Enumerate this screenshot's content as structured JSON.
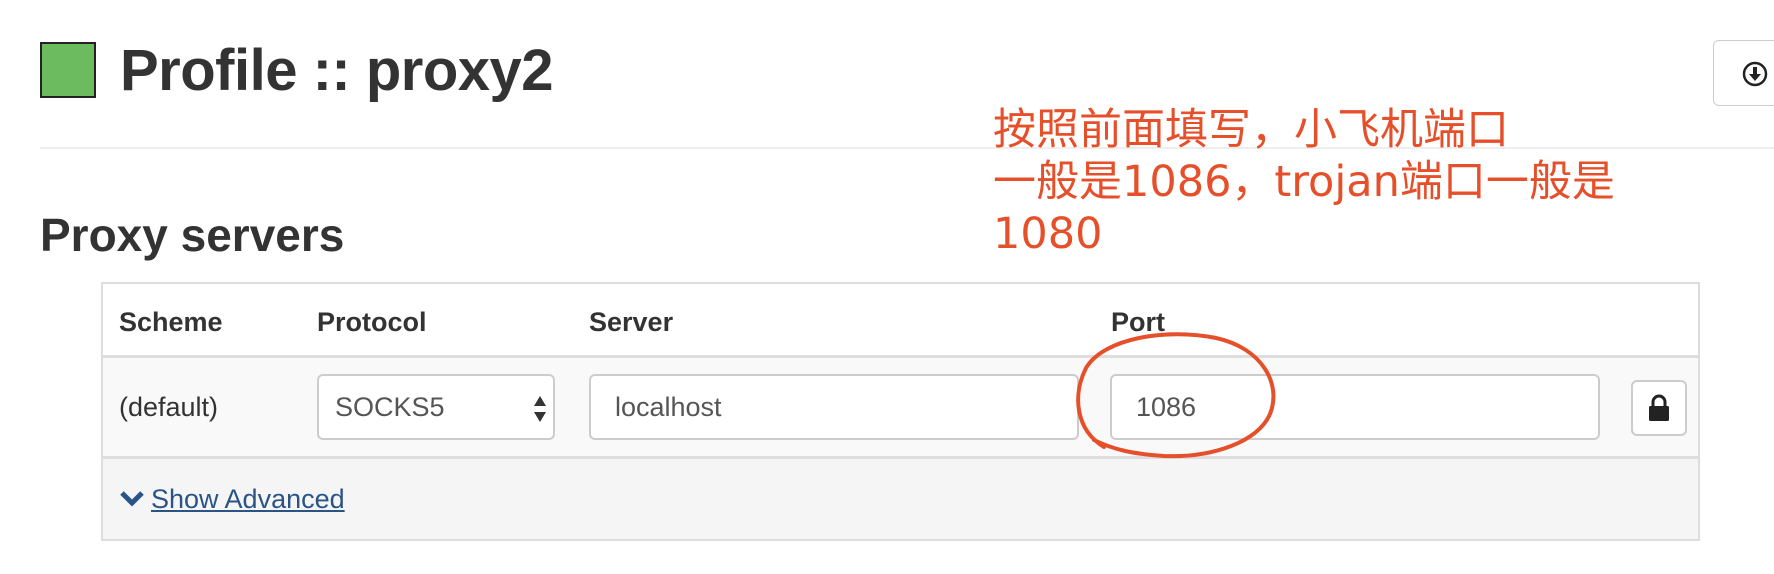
{
  "profile": {
    "title": "Profile :: proxy2",
    "swatch_color": "#6cbb5e",
    "export_icon": "download-circle-icon"
  },
  "proxy_servers": {
    "section_title": "Proxy servers",
    "columns": [
      "Scheme",
      "Protocol",
      "Server",
      "Port",
      ""
    ],
    "rows": [
      {
        "scheme": "(default)",
        "protocol": "SOCKS5",
        "server": "localhost",
        "port": "1086",
        "lock_icon": "lock-icon"
      }
    ],
    "show_advanced": "Show Advanced",
    "show_advanced_icon": "chevron-down-icon"
  },
  "annotation": {
    "text": "按照前面填写，小飞机端口\n一般是1086，trojan端口一般是\n1080",
    "color": "#e5502a"
  },
  "colors": {
    "link": "#2a5486",
    "text": "#333333",
    "border": "#dddddd"
  }
}
